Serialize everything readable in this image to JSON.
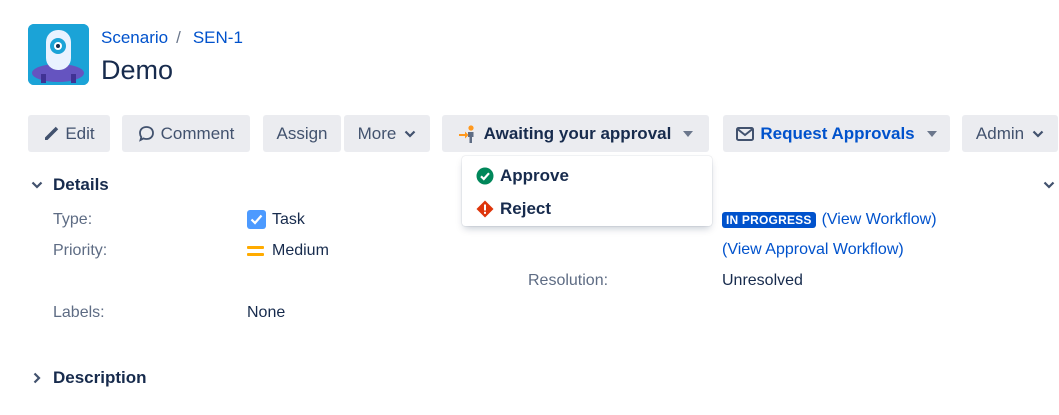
{
  "breadcrumb": {
    "project": "Scenario",
    "separator": "/",
    "issue_key": "SEN-1"
  },
  "issue": {
    "title": "Demo"
  },
  "toolbar": {
    "edit_label": "Edit",
    "comment_label": "Comment",
    "assign_label": "Assign",
    "more_label": "More",
    "approval_label": "Awaiting your approval",
    "request_approvals_label": "Request Approvals",
    "admin_label": "Admin"
  },
  "approval_menu": {
    "approve_label": "Approve",
    "reject_label": "Reject"
  },
  "details": {
    "heading": "Details",
    "type_label": "Type:",
    "type_value": "Task",
    "priority_label": "Priority:",
    "priority_value": "Medium",
    "labels_label": "Labels:",
    "labels_value": "None",
    "status_value": "IN PROGRESS",
    "view_workflow": "(View Workflow)",
    "view_approval_workflow": "(View Approval Workflow)",
    "resolution_label": "Resolution:",
    "resolution_value": "Unresolved"
  },
  "description": {
    "heading": "Description"
  },
  "colors": {
    "link": "#0052cc",
    "button_bg": "#ebecf0",
    "approve_green": "#00875a",
    "reject_red": "#de350b",
    "priority_orange": "#ffab00",
    "status_blue": "#0052cc"
  },
  "icons": {
    "avatar": "project-avatar-icon",
    "edit": "pencil-icon",
    "comment": "comment-icon",
    "approval": "person-arrow-icon",
    "request": "envelope-icon",
    "approve": "check-circle-icon",
    "reject": "error-icon",
    "type": "task-checkbox-icon",
    "priority": "priority-medium-icon"
  }
}
